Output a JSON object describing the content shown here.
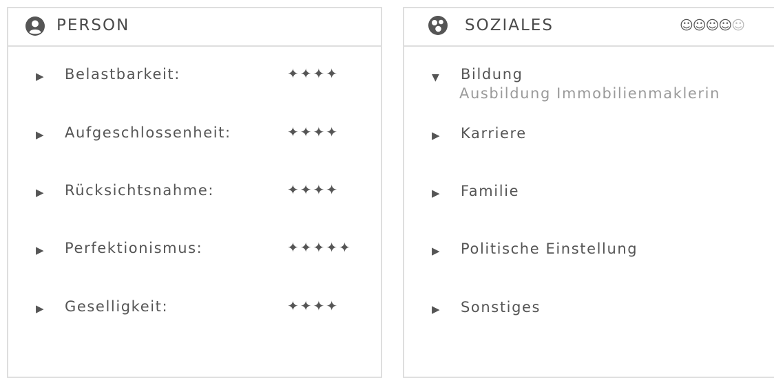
{
  "person": {
    "title": "PERSON",
    "icon": "user-circle-icon",
    "traits": [
      {
        "label": "Belastbarkeit:",
        "stars": "✦✦✦✦",
        "rating": 4
      },
      {
        "label": "Aufgeschlossenheit:",
        "stars": "✦✦✦✦",
        "rating": 4
      },
      {
        "label": "Rücksichtsnahme:",
        "stars": "✦✦✦✦",
        "rating": 4
      },
      {
        "label": "Perfektionismus:",
        "stars": "✦✦✦✦✦",
        "rating": 5
      },
      {
        "label": "Geselligkeit:",
        "stars": "✦✦✦✦",
        "rating": 4
      }
    ]
  },
  "soziales": {
    "title": "SOZIALES",
    "icon": "social-circles-icon",
    "smileys_on": "☺☺☺☺",
    "smileys_off": "☺",
    "rating": 4,
    "rating_max": 5,
    "sections": [
      {
        "label": "Bildung",
        "expanded": true,
        "arrow": "▼",
        "detail": "Ausbildung Immobilienmaklerin"
      },
      {
        "label": "Karriere",
        "expanded": false,
        "arrow": "▶"
      },
      {
        "label": "Familie",
        "expanded": false,
        "arrow": "▶"
      },
      {
        "label": "Politische Einstellung",
        "expanded": false,
        "arrow": "▶"
      },
      {
        "label": "Sonstiges",
        "expanded": false,
        "arrow": "▶"
      }
    ]
  },
  "arrow_collapsed": "▶",
  "colors": {
    "text": "#555555",
    "muted": "#9a9a9a",
    "border": "#dedede",
    "smiley_off": "#b9b9b9"
  }
}
